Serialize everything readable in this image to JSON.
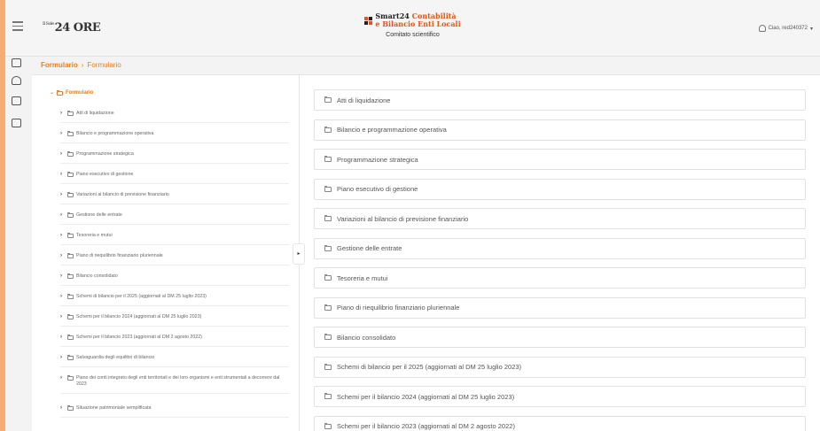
{
  "header": {
    "logo_prefix": "Il Sole",
    "logo": "24 ORE",
    "brand_line1": "Smart24",
    "brand_line1_accent": "Contabilità",
    "brand_line2": "e Bilancio Enti Locali",
    "brand_sub": "Comitato scientifico",
    "user": "Ciao, red240372",
    "user_caret": "▾"
  },
  "breadcrumb": {
    "root": "Formulario",
    "separator": "›",
    "current": "Formulario"
  },
  "tree": {
    "root": "Formulario",
    "items": [
      "Atti di liquidazione",
      "Bilancio e programmazione operativa",
      "Programmazione strategica",
      "Piano esecutivo di gestione",
      "Variazioni al bilancio di previsione finanziario",
      "Gestione delle entrate",
      "Tesoreria e mutui",
      "Piano di riequilibrio finanziario pluriennale",
      "Bilancio consolidato",
      "Schemi di bilancio per il 2025 (aggiornati al DM 25 luglio 2023)",
      "Schemi per il bilancio 2024 (aggiornati al DM 25 luglio 2023)",
      "Schemi per il bilancio 2023 (aggiornati al DM 2 agosto 2022)",
      "Salvaguardia degli equilibri di bilancio",
      "Piano dei conti integrato degli enti territoriali e dei loro organismi e enti strumentali a decorrere dal 2023",
      "Situazione patrimoniale semplificata"
    ]
  },
  "list": {
    "items": [
      "Atti di liquidazione",
      "Bilancio e programmazione operativa",
      "Programmazione strategica",
      "Piano esecutivo di gestione",
      "Variazioni al bilancio di previsione finanziario",
      "Gestione delle entrate",
      "Tesoreria e mutui",
      "Piano di riequilibrio finanziario pluriennale",
      "Bilancio consolidato",
      "Schemi di bilancio per il 2025 (aggiornati al DM 25 luglio 2023)",
      "Schemi per il bilancio 2024 (aggiornati al DM 25 luglio 2023)",
      "Schemi per il bilancio 2023 (aggiornati al DM 2 agosto 2022)"
    ]
  },
  "icons": {
    "menu": "hamburger-icon",
    "user": "user-icon",
    "rail": [
      "grid-icon",
      "user-group-icon",
      "document-icon",
      "chat-icon"
    ],
    "folder": "folder-icon",
    "chevron": "chevron-right-icon"
  },
  "colors": {
    "accent": "#e8801c",
    "brand": "#e8521c",
    "background": "#f6ad73"
  }
}
